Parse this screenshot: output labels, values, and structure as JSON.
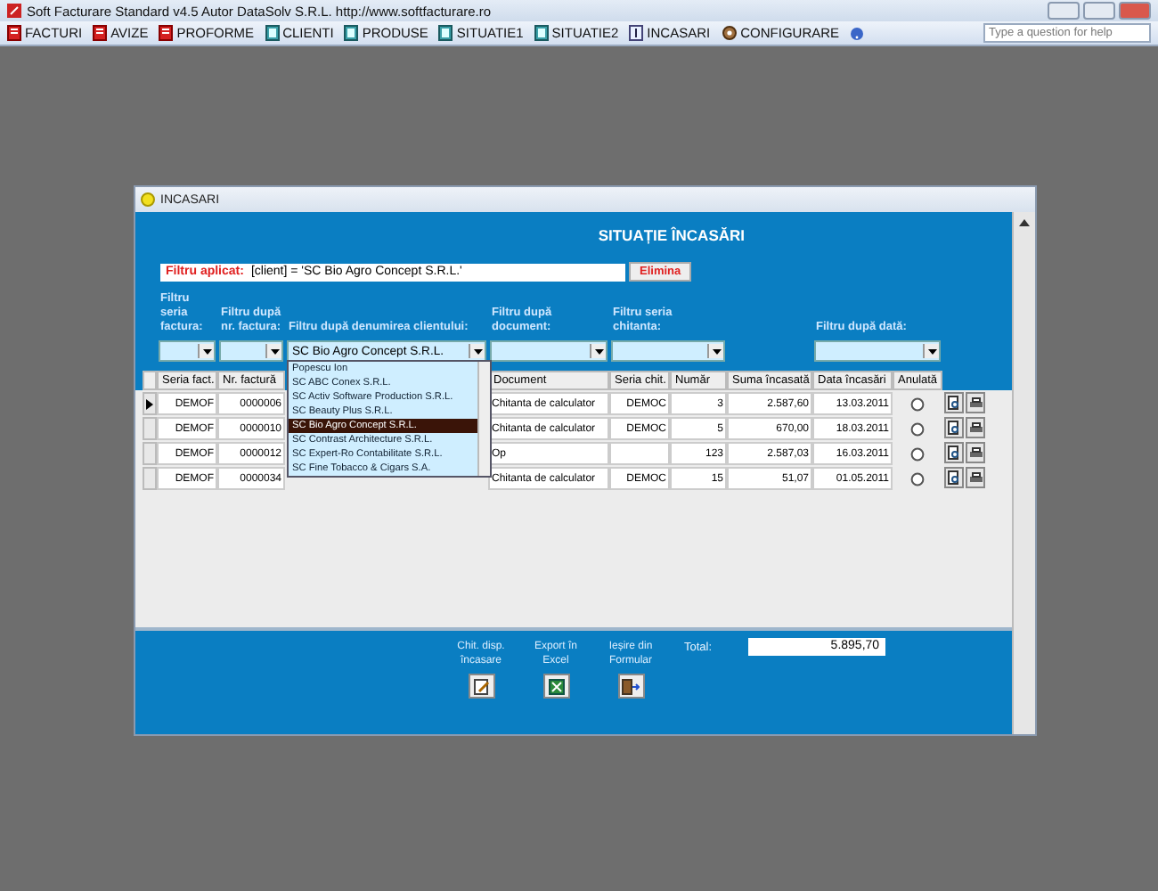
{
  "app": {
    "title": "Soft Facturare Standard v4.5 Autor DataSolv S.R.L. http://www.softfacturare.ro",
    "help_placeholder": "Type a question for help"
  },
  "menu": [
    {
      "label": "FACTURI",
      "kind": "document"
    },
    {
      "label": "AVIZE",
      "kind": "document"
    },
    {
      "label": "PROFORME",
      "kind": "document"
    },
    {
      "label": "CLIENTI",
      "kind": "list"
    },
    {
      "label": "PRODUSE",
      "kind": "list"
    },
    {
      "label": "SITUATIE1",
      "kind": "list"
    },
    {
      "label": "SITUATIE2",
      "kind": "list"
    },
    {
      "label": "INCASARI",
      "kind": "info"
    },
    {
      "label": "CONFIGURARE",
      "kind": "settings"
    }
  ],
  "form": {
    "title": "INCASARI",
    "heading": "SITUAȚIE ÎNCASĂRI",
    "applied_filter": {
      "label": "Filtru aplicat:",
      "value": "[client] = 'SC Bio Agro Concept S.R.L.'",
      "button": "Elimina"
    },
    "filters": [
      {
        "label": "Filtru seria factura:"
      },
      {
        "label": "Filtru după nr. factura:"
      },
      {
        "label": "Filtru după denumirea clientului:",
        "value": "SC Bio Agro Concept S.R.L.",
        "expanded": true
      },
      {
        "label": "Filtru după document:"
      },
      {
        "label": "Filtru seria chitanta:"
      },
      {
        "label": "Filtru după dată:"
      }
    ],
    "client_options": [
      {
        "label": "Popescu Ion",
        "selected": false
      },
      {
        "label": "SC ABC Conex S.R.L.",
        "selected": false
      },
      {
        "label": "SC Activ Software Production S.R.L.",
        "selected": false
      },
      {
        "label": "SC Beauty Plus S.R.L.",
        "selected": false
      },
      {
        "label": "SC Bio Agro Concept S.R.L.",
        "selected": true
      },
      {
        "label": "SC Contrast Architecture S.R.L.",
        "selected": false
      },
      {
        "label": "SC Expert-Ro Contabilitate S.R.L.",
        "selected": false
      },
      {
        "label": "SC Fine Tobacco & Cigars S.A.",
        "selected": false
      }
    ],
    "columns": [
      "Seria fact.",
      "Nr. factură",
      "Document",
      "Seria chit.",
      "Număr",
      "Suma încasată",
      "Data încasări",
      "Anulată"
    ],
    "rows": [
      {
        "current": true,
        "cancelled": false,
        "cells": [
          "DEMOF",
          "0000006",
          "Chitanta de calculator",
          "DEMOC",
          "3",
          "2.587,60",
          "13.03.2011"
        ]
      },
      {
        "current": false,
        "cancelled": false,
        "cells": [
          "DEMOF",
          "0000010",
          "Chitanta de calculator",
          "DEMOC",
          "5",
          "670,00",
          "18.03.2011"
        ]
      },
      {
        "current": false,
        "cancelled": false,
        "cells": [
          "DEMOF",
          "0000012",
          "Op",
          "",
          "123",
          "2.587,03",
          "16.03.2011"
        ]
      },
      {
        "current": false,
        "cancelled": false,
        "cells": [
          "DEMOF",
          "0000034",
          "Chitanta de calculator",
          "DEMOC",
          "15",
          "51,07",
          "01.05.2011"
        ]
      }
    ],
    "footer_buttons": [
      {
        "label": "Chit. disp. încasare",
        "kind": "edit"
      },
      {
        "label": "Export în Excel",
        "kind": "excel"
      },
      {
        "label": "Ieșire din Formular",
        "kind": "exit"
      }
    ],
    "total_label": "Total:",
    "total": "5.895,70"
  }
}
